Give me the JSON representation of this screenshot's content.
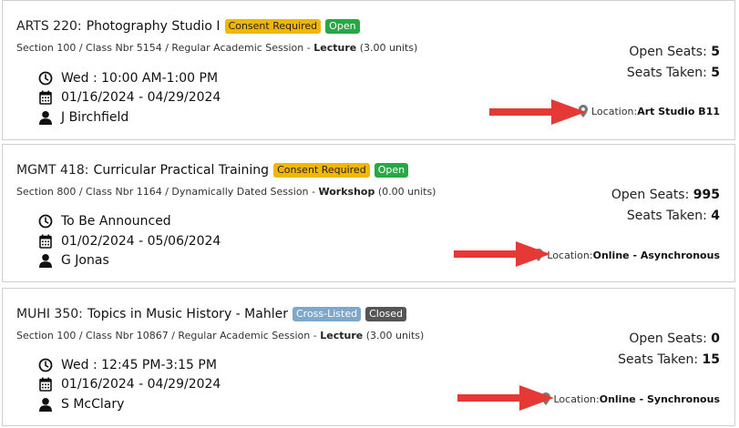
{
  "courses": [
    {
      "code": "ARTS 220:",
      "title": "Photography Studio I",
      "badges": [
        "Consent Required",
        "Open"
      ],
      "section_prefix": "Section 100 / Class Nbr 5154 / Regular Academic Session - ",
      "component": "Lecture",
      "units": " (3.00 units)",
      "schedule": "Wed : 10:00 AM-1:00 PM",
      "dates": "01/16/2024 - 04/29/2024",
      "instructor": "J Birchfield",
      "open_seats_label": "Open Seats: ",
      "open_seats": "5",
      "seats_taken_label": "Seats Taken: ",
      "seats_taken": "5",
      "location_label": "Location: ",
      "location": "Art Studio B11"
    },
    {
      "code": "MGMT 418:",
      "title": "Curricular Practical Training",
      "badges": [
        "Consent Required",
        "Open"
      ],
      "section_prefix": "Section 800 / Class Nbr 1164 / Dynamically Dated Session - ",
      "component": "Workshop",
      "units": " (0.00 units)",
      "schedule": "To Be Announced",
      "dates": "01/02/2024 - 05/06/2024",
      "instructor": "G Jonas",
      "open_seats_label": "Open Seats: ",
      "open_seats": "995",
      "seats_taken_label": "Seats Taken: ",
      "seats_taken": "4",
      "location_label": "Location: ",
      "location": "Online - Asynchronous"
    },
    {
      "code": "MUHI 350:",
      "title": "Topics in Music History - Mahler",
      "badges": [
        "Cross-Listed",
        "Closed"
      ],
      "section_prefix": "Section 100 / Class Nbr 10867 / Regular Academic Session - ",
      "component": "Lecture",
      "units": " (3.00 units)",
      "schedule": "Wed : 12:45 PM-3:15 PM",
      "dates": "01/16/2024 - 04/29/2024",
      "instructor": "S McClary",
      "open_seats_label": "Open Seats: ",
      "open_seats": "0",
      "seats_taken_label": "Seats Taken: ",
      "seats_taken": "15",
      "location_label": "Location: ",
      "location": "Online - Synchronous"
    }
  ],
  "colors": {
    "consent_badge": "#f2b705",
    "open_badge": "#28a745",
    "cross_listed_badge": "#7fa7c9",
    "closed_badge": "#555555",
    "annotation_arrow": "#e53935"
  },
  "icons": [
    "clock-icon",
    "calendar-icon",
    "person-icon",
    "map-pin-icon",
    "arrow-annotation"
  ]
}
